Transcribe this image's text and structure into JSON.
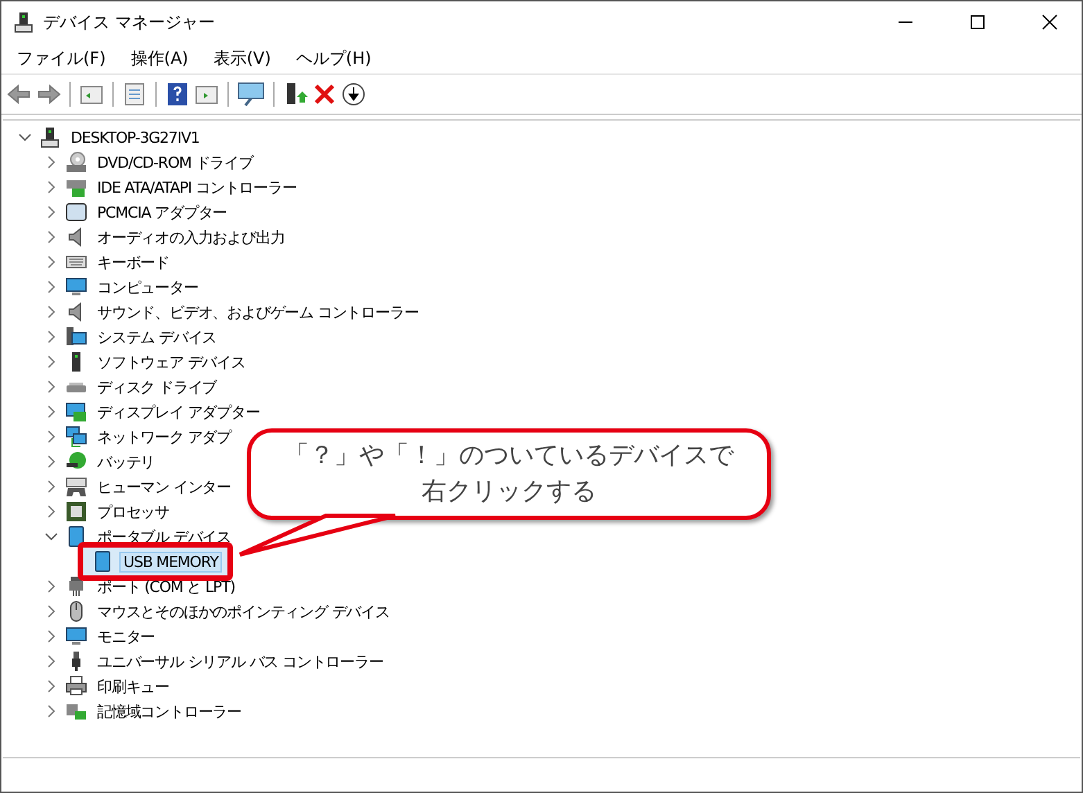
{
  "window": {
    "title": "デバイス マネージャー"
  },
  "menu": [
    "ファイル(F)",
    "操作(A)",
    "表示(V)",
    "ヘルプ(H)"
  ],
  "tree": {
    "label": "DESKTOP-3G27IV1",
    "expanded": true,
    "children": [
      {
        "label": "DVD/CD-ROM ドライブ",
        "expanded": false
      },
      {
        "label": "IDE ATA/ATAPI コントローラー",
        "expanded": false
      },
      {
        "label": "PCMCIA アダプター",
        "expanded": false
      },
      {
        "label": "オーディオの入力および出力",
        "expanded": false
      },
      {
        "label": "キーボード",
        "expanded": false
      },
      {
        "label": "コンピューター",
        "expanded": false
      },
      {
        "label": "サウンド、ビデオ、およびゲーム コントローラー",
        "expanded": false
      },
      {
        "label": "システム デバイス",
        "expanded": false
      },
      {
        "label": "ソフトウェア デバイス",
        "expanded": false
      },
      {
        "label": "ディスク ドライブ",
        "expanded": false
      },
      {
        "label": "ディスプレイ アダプター",
        "expanded": false
      },
      {
        "label": "ネットワーク アダプ",
        "expanded": false
      },
      {
        "label": "バッテリ",
        "expanded": false
      },
      {
        "label": "ヒューマン インター",
        "expanded": false
      },
      {
        "label": "プロセッサ",
        "expanded": false
      },
      {
        "label": "ポータブル デバイス",
        "expanded": true,
        "children": [
          {
            "label": "USB MEMORY",
            "selected": true,
            "highlighted": true
          }
        ]
      },
      {
        "label": "ポート (COM と LPT)",
        "expanded": false
      },
      {
        "label": "マウスとそのほかのポインティング デバイス",
        "expanded": false
      },
      {
        "label": "モニター",
        "expanded": false
      },
      {
        "label": "ユニバーサル シリアル バス コントローラー",
        "expanded": false
      },
      {
        "label": "印刷キュー",
        "expanded": false
      },
      {
        "label": "記憶域コントローラー",
        "expanded": false
      }
    ]
  },
  "callout": {
    "lines": [
      "「？」や「！」のついているデバイスで",
      "右クリックする"
    ]
  }
}
